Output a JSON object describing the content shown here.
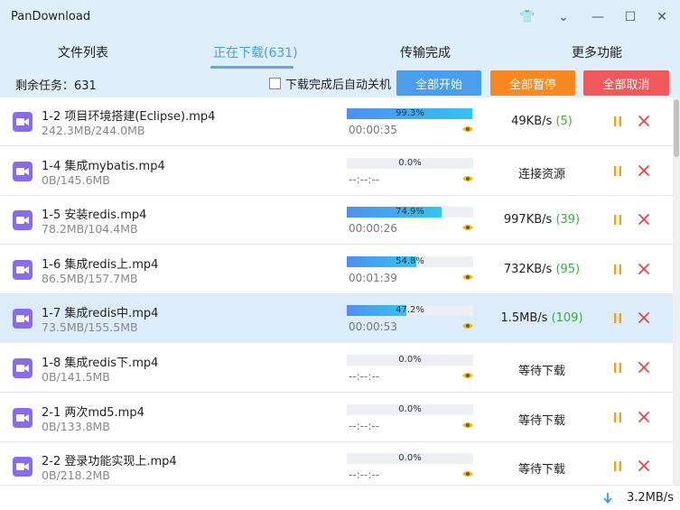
{
  "app": {
    "title": "PanDownload"
  },
  "window_controls": {
    "skin": "👕",
    "menu": "⌄",
    "minimize": "—",
    "maximize": "☐",
    "close": "✕"
  },
  "tabs": [
    {
      "label": "文件列表",
      "active": false
    },
    {
      "label": "正在下载(631)",
      "active": true
    },
    {
      "label": "传输完成",
      "active": false
    },
    {
      "label": "更多功能",
      "active": false
    }
  ],
  "toolbar": {
    "remaining_label": "剩余任务：",
    "remaining_count": "631",
    "auto_shutdown_label": "下载完成后自动关机",
    "start_all": "全部开始",
    "pause_all": "全部暂停",
    "cancel_all": "全部取消"
  },
  "colors": {
    "accent": "#4a9de8",
    "start_btn": "#4a9eea",
    "pause_btn": "#f6891f",
    "cancel_btn": "#f0585c",
    "pause_icon": "#f0a21c",
    "cancel_icon": "#e5464a",
    "connections": "#3cae3c"
  },
  "downloads": [
    {
      "name": "1-2 项目环境搭建(Eclipse).mp4",
      "size": "242.3MB/244.0MB",
      "progress": 99.3,
      "progress_text": "99.3%",
      "eta": "00:00:35",
      "speed": "49KB/s",
      "connections": "(5)",
      "status": "",
      "selected": false
    },
    {
      "name": "1-4 集成mybatis.mp4",
      "size": "0B/145.6MB",
      "progress": 0,
      "progress_text": "0.0%",
      "eta": "--:--:--",
      "speed": "",
      "connections": "",
      "status": "连接资源",
      "selected": false
    },
    {
      "name": "1-5 安装redis.mp4",
      "size": "78.2MB/104.4MB",
      "progress": 74.9,
      "progress_text": "74.9%",
      "eta": "00:00:26",
      "speed": "997KB/s",
      "connections": "(39)",
      "status": "",
      "selected": false
    },
    {
      "name": "1-6 集成redis上.mp4",
      "size": "86.5MB/157.7MB",
      "progress": 54.8,
      "progress_text": "54.8%",
      "eta": "00:01:39",
      "speed": "732KB/s",
      "connections": "(95)",
      "status": "",
      "selected": false
    },
    {
      "name": "1-7 集成redis中.mp4",
      "size": "73.5MB/155.5MB",
      "progress": 47.2,
      "progress_text": "47.2%",
      "eta": "00:00:53",
      "speed": "1.5MB/s",
      "connections": "(109)",
      "status": "",
      "selected": true
    },
    {
      "name": "1-8 集成redis下.mp4",
      "size": "0B/141.5MB",
      "progress": 0,
      "progress_text": "0.0%",
      "eta": "--:--:--",
      "speed": "",
      "connections": "",
      "status": "等待下载",
      "selected": false
    },
    {
      "name": "2-1 两次md5.mp4",
      "size": "0B/133.8MB",
      "progress": 0,
      "progress_text": "0.0%",
      "eta": "--:--:--",
      "speed": "",
      "connections": "",
      "status": "等待下载",
      "selected": false
    },
    {
      "name": "2-2 登录功能实现上.mp4",
      "size": "0B/218.2MB",
      "progress": 0,
      "progress_text": "0.0%",
      "eta": "--:--:--",
      "speed": "",
      "connections": "",
      "status": "等待下载",
      "selected": false
    }
  ],
  "statusbar": {
    "total_speed": "3.2MB/s"
  }
}
